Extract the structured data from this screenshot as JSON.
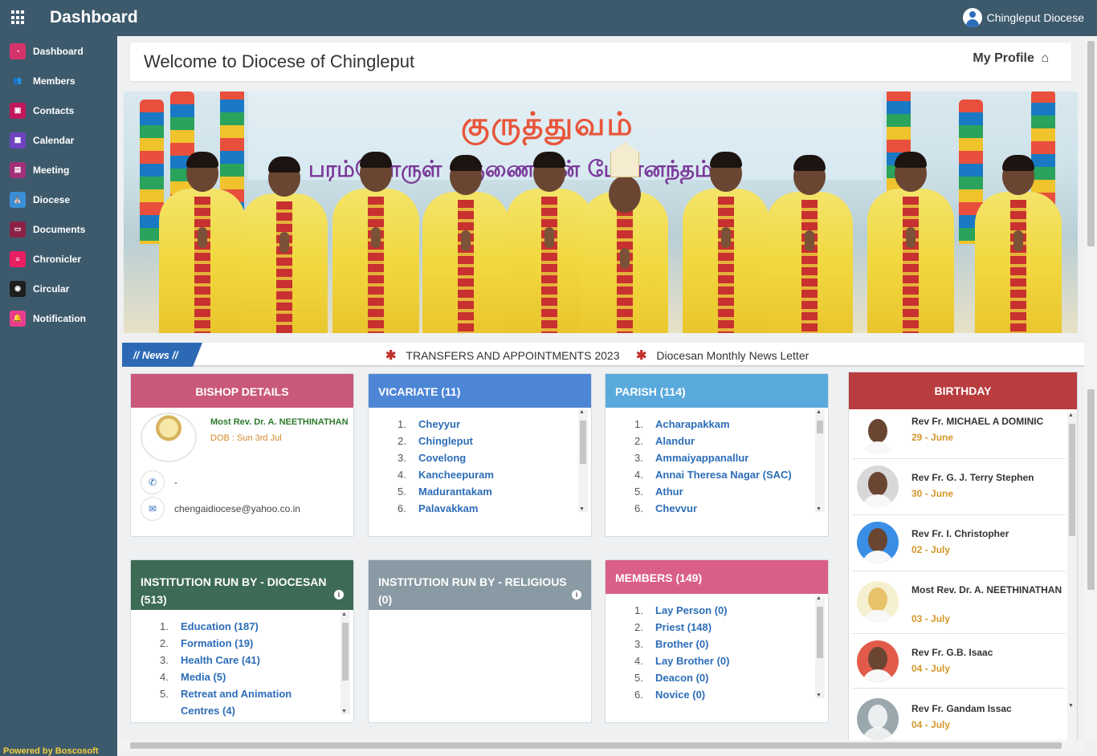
{
  "topbar": {
    "title": "Dashboard",
    "user_name": "Chingleput Diocese",
    "menu_icon": "grid-icon",
    "user_icon": "user-circle-icon"
  },
  "sidebar": {
    "items": [
      {
        "label": "Dashboard",
        "icon": "dashboard-icon",
        "color": "#d6336c"
      },
      {
        "label": "Members",
        "icon": "users-icon",
        "color": "#3d5a6c"
      },
      {
        "label": "Contacts",
        "icon": "contacts-icon",
        "color": "#c2185b"
      },
      {
        "label": "Calendar",
        "icon": "calendar-icon",
        "color": "#6f42c1"
      },
      {
        "label": "Meeting",
        "icon": "meeting-icon",
        "color": "#a2307a"
      },
      {
        "label": "Diocese",
        "icon": "diocese-icon",
        "color": "#3a8fd6"
      },
      {
        "label": "Documents",
        "icon": "documents-icon",
        "color": "#8b2147"
      },
      {
        "label": "Chronicler",
        "icon": "chronicler-icon",
        "color": "#e91e63"
      },
      {
        "label": "Circular",
        "icon": "circular-icon",
        "color": "#1e1e1e"
      },
      {
        "label": "Notification",
        "icon": "bell-icon",
        "color": "#e83e8c"
      }
    ],
    "powered_by": "Powered by Boscosoft"
  },
  "welcome": {
    "title": "Welcome to Diocese of Chingleput",
    "profile_label": "My Profile",
    "profile_icon": "home-icon"
  },
  "banner": {
    "line1": "குருத்துவம்",
    "line2": "பரம்பொருள் கருணையின் பேரானந்தம்"
  },
  "news": {
    "label": "// News //",
    "items": [
      "TRANSFERS AND APPOINTMENTS 2023",
      "Diocesan Monthly News Letter"
    ]
  },
  "bishop": {
    "title": "BISHOP DETAILS",
    "name": "Most Rev. Dr. A. NEETHINATHAN",
    "dob": "DOB : Sun 3rd Jul",
    "phone": "-",
    "email": "chengaidiocese@yahoo.co.in"
  },
  "vicariate": {
    "title": "VICARIATE (11)",
    "items": [
      "Cheyyur",
      "Chingleput",
      "Covelong",
      "Kancheepuram",
      "Madurantakam",
      "Palavakkam"
    ]
  },
  "parish": {
    "title": "PARISH (114)",
    "items": [
      "Acharapakkam",
      "Alandur",
      "Ammaiyappanallur",
      "Annai Theresa Nagar (SAC)",
      "Athur",
      "Chevvur"
    ]
  },
  "inst_diocesan": {
    "title": "INSTITUTION RUN BY - DIOCESAN",
    "count": "(513)",
    "items": [
      "Education (187)",
      "Formation (19)",
      "Health Care (41)",
      "Media (5)",
      "Retreat and Animation",
      "Centres (4)"
    ]
  },
  "inst_religious": {
    "title": "INSTITUTION RUN BY - RELIGIOUS",
    "count": "(0)"
  },
  "members": {
    "title": "MEMBERS (149)",
    "items": [
      "Lay Person (0)",
      "Priest (148)",
      "Brother (0)",
      "Lay Brother (0)",
      "Deacon (0)",
      "Novice (0)"
    ]
  },
  "birthday": {
    "title": "BIRTHDAY",
    "entries": [
      {
        "name": "Rev Fr. MICHAEL A DOMINIC",
        "day": "29",
        "month": "June"
      },
      {
        "name": "Rev Fr. G. J. Terry Stephen",
        "day": "30",
        "month": "June"
      },
      {
        "name": "Rev Fr. I. Christopher",
        "day": "02",
        "month": "July"
      },
      {
        "name": "Most Rev. Dr. A. NEETHINATHAN",
        "day": "03",
        "month": "July"
      },
      {
        "name": "Rev Fr. G.B. Isaac",
        "day": "04",
        "month": "July"
      },
      {
        "name": "Rev Fr. Gandam Issac",
        "day": "04",
        "month": "July"
      }
    ]
  },
  "colors": {
    "sidebar": "#3d5a6c",
    "bishop_header": "#c9587a",
    "vicariate_header": "#4e86d6",
    "parish_header": "#5aa9dc",
    "inst_diocesan_header": "#3d6b55",
    "inst_religious_header": "#8a9aa4",
    "members_header": "#d95f86",
    "birthday_header": "#b93c3e"
  }
}
